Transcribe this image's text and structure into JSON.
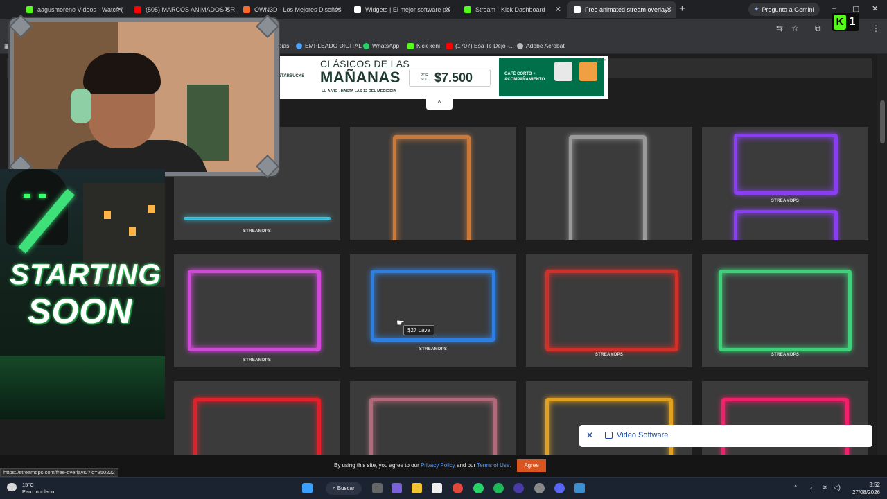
{
  "browser": {
    "tabs": [
      {
        "label": "aagusmoreno Videos - Watch (",
        "color": "#53fc18"
      },
      {
        "label": "(505) MARCOS ANIMADOS GR",
        "color": "#ff0000"
      },
      {
        "label": "OWN3D - Los Mejores Diseños",
        "color": "#ff6a2a"
      },
      {
        "label": "Widgets | El mejor software pa",
        "color": "#ffffff"
      },
      {
        "label": "Stream - Kick Dashboard",
        "color": "#53fc18"
      },
      {
        "label": "Free animated stream overlays",
        "color": "#ffffff"
      }
    ],
    "new_tab": "+",
    "gemini": "Pregunta a Gemini",
    "bookmarks": [
      {
        "label": "ticias",
        "color": "#888888"
      },
      {
        "label": "EMPLEADO DIGITAL",
        "color": "#4aa3ff"
      },
      {
        "label": "WhatsApp",
        "color": "#25d366"
      },
      {
        "label": "Kick keni",
        "color": "#53fc18"
      },
      {
        "label": "(1707) Esa Te Dejó -...",
        "color": "#ff0000"
      },
      {
        "label": "Adobe Acrobat",
        "color": "#bbbbbb"
      }
    ]
  },
  "kick_badge": {
    "letter": "K",
    "count": "1"
  },
  "ad": {
    "brand": "STARBUCKS",
    "line1": "CLÁSICOS DE LAS",
    "line2": "MAÑANAS",
    "line3": "LU A VIE - HASTA LAS 12 DEL MEDIODÍA",
    "por_solo": "POR SOLO",
    "price": "$7.500",
    "combo": "CAFÉ CORTO + ACOMPAÑAMIENTO",
    "adchoices": "ⓘ ✕",
    "collapse": "^"
  },
  "grid": {
    "row1": [
      {
        "label": "STREAMDPS",
        "accent": "#37c9e6"
      },
      {
        "label": "",
        "accent": "#c97a3a"
      },
      {
        "label": "",
        "accent": "#9a9a9a"
      },
      {
        "label": "STREAMDPS",
        "accent": "#8a3ef2"
      }
    ],
    "row2": [
      {
        "label": "STREAMDPS",
        "accent": "#d04ad8"
      },
      {
        "label": "STREAMDPS",
        "accent": "#2f7fe0"
      },
      {
        "label": "STREAMDPS",
        "accent": "#d0302a"
      },
      {
        "label": "STREAMDPS",
        "accent": "#3fd07a"
      }
    ],
    "row3": [
      {
        "label": "",
        "accent": "#e0202a"
      },
      {
        "label": "",
        "accent": "#b06a7a"
      },
      {
        "label": "",
        "accent": "#e0a020"
      },
      {
        "label": "",
        "accent": "#f0206a"
      }
    ],
    "tooltip": "$27 Lava"
  },
  "starting_soon": {
    "line1": "STARTING",
    "line2": "SOON"
  },
  "video_software": {
    "close": "✕",
    "label": "Video Software"
  },
  "cookie": {
    "pre": "By using this site, you agree to our",
    "privacy": "Privacy Policy",
    "mid": "and our",
    "terms": "Terms of Use.",
    "agree": "Agree"
  },
  "status_url": "https://streamdps.com/free-overlays/?id=850222",
  "taskbar": {
    "temp": "15°C",
    "weather": "Parc. nublado",
    "search": "Buscar",
    "time": "3:52",
    "date": "27/08/2026"
  }
}
